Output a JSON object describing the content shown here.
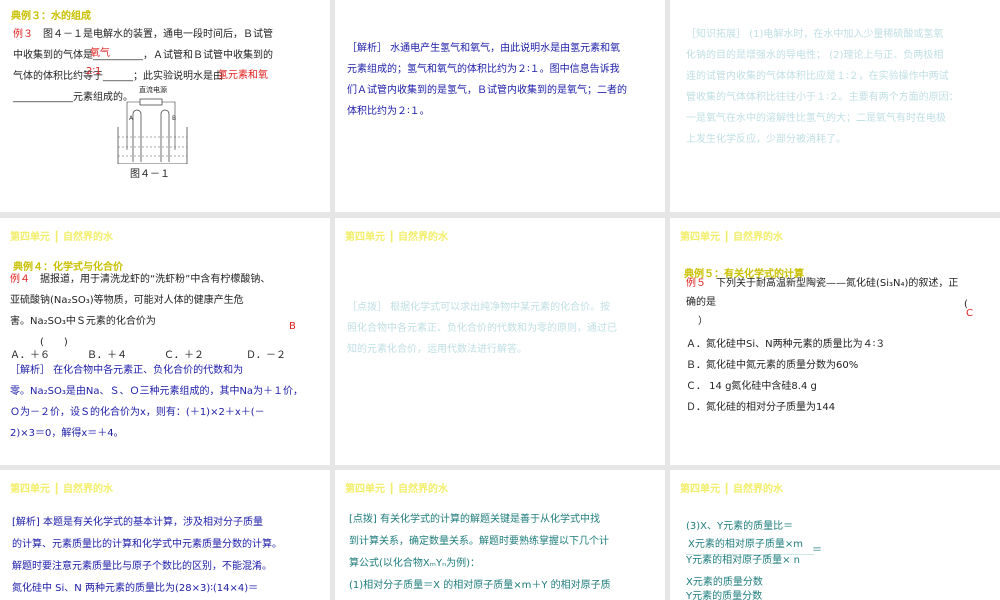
{
  "unit_header": "第四单元 ┃  自然界的水",
  "p1": {
    "title": "典例３：水的组成",
    "label": "例３",
    "lines": [
      "图４－１是电解水的装置，通电一段时间后，Ｂ试管",
      "中收集到的气体是__________，Ａ试管和Ｂ试管中收集到的",
      "气体的体积比约等于______；此实验说明水是由",
      "____________元素组成的。"
    ],
    "answers": [
      "氧气",
      "2∶1",
      "氢元素和氧"
    ],
    "figure_caption": "图４－１",
    "power_label": "直流电源",
    "tube_a": "A",
    "tube_b": "B"
  },
  "p2": {
    "lines": [
      "［解析］ 水通电产生氢气和氧气，由此说明水是由氢元素和氧",
      "元素组成的；氢气和氧气的体积比约为２∶１。图中信息告诉我",
      "们Ａ试管内收集到的是氢气，Ｂ试管内收集到的是氧气；二者的",
      "体积比约为２∶１。"
    ]
  },
  "p3": {
    "lines": [
      "［知识拓展］ (1)电解水时，在水中加入少量稀硫酸或氢氧",
      "化钠的目的是增强水的导电性； (2)理论上与正、负两极相",
      "连的试管内收集的气体体积比应是１∶２，在实验操作中两试",
      "管收集的气体体积比往往小于１∶２。主要有两个方面的原因：",
      "一是氧气在水中的溶解性比氢气的大；二是氧气有时在电极",
      "上发生化学反应，少部分被消耗了。"
    ]
  },
  "p4": {
    "title": "典例４：化学式与化合价",
    "label": "例４",
    "lines": [
      "据报道，用于清洗龙虾的“洗虾粉”中含有柠檬酸钠、",
      "亚硫酸钠(Na₂SO₃)等物质，可能对人体的健康产生危",
      "害。Na₂SO₃中Ｓ元素的化合价为",
      "(　　)"
    ],
    "answer": "B",
    "options": [
      "Ａ．＋６",
      "Ｂ．＋４",
      "Ｃ．＋２",
      "Ｄ．－２"
    ],
    "analysis": [
      "［解析］ 在化合物中各元素正、负化合价的代数和为",
      "零。Na₂SO₃是由Na、Ｓ、Ｏ三种元素组成的，其中Na为＋１价，",
      "Ｏ为－２价，设Ｓ的化合价为x，则有：(＋1)×2＋x＋(－",
      "2)×3＝0，解得x＝＋4。"
    ]
  },
  "p5": {
    "lines": [
      "［点拨］ 根据化学式可以求出纯净物中某元素的化合价。按",
      "照化合物中各元素正、负化合价的代数和为零的原则，通过已",
      "知的元素化合价，运用代数法进行解答。"
    ]
  },
  "p6": {
    "title": "典例５：有关化学式的计算",
    "label": "例５",
    "lines": [
      "下列关于耐高温新型陶瓷——氮化硅(Si₃N₄)的叙述，正",
      "确的是",
      "）"
    ],
    "paren": "(",
    "answer": "C",
    "options": [
      "Ａ．氮化硅中Si、N两种元素的质量比为４∶３",
      "Ｂ．氮化硅中氮元素的质量分数为60%",
      "Ｃ． 14 g氮化硅中含硅8.4 g",
      "Ｄ．氮化硅的相对分子质量为144"
    ]
  },
  "p7": {
    "lines": [
      "[解析] 本题是有关化学式的基本计算，涉及相对分子质量",
      "的计算、元素质量比的计算和化学式中元素质量分数的计算。",
      "解题时要注意元素质量比与原子个数比的区别，不能混淆。",
      "氮化硅中 Si、N 两种元素的质量比为(28×3)∶(14×4)＝"
    ]
  },
  "p8": {
    "lines": [
      "[点拨] 有关化学式的计算的解题关键是善于从化学式中找",
      "到计算关系，确定数量关系。解题时要熟练掌握以下几个计",
      "算公式(以化合物XₘYₙ为例)：",
      "(1)相对分子质量＝X 的相对原子质量×m＋Y 的相对原子质"
    ]
  },
  "p9": {
    "line1": "(3)X、Y元素的质量比＝",
    "num": "X元素的相对原子质量×m",
    "den": "Y元素的相对原子质量× n",
    "eq": "＝",
    "num2": "X元素的质量分数",
    "den2": "Y元素的质量分数"
  }
}
